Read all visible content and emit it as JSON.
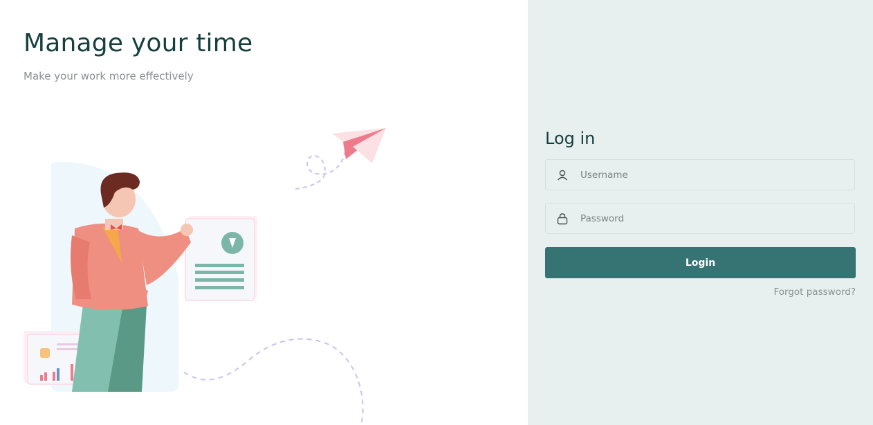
{
  "hero": {
    "title": "Manage your time",
    "subtitle": "Make your work more effectively"
  },
  "login": {
    "title": "Log in",
    "username": {
      "value": "",
      "placeholder": "Username",
      "icon": "user-icon"
    },
    "password": {
      "value": "",
      "placeholder": "Password",
      "icon": "lock-icon"
    },
    "submit_label": "Login",
    "forgot_label": "Forgot password?"
  },
  "colors": {
    "brand_dark": "#15403e",
    "button": "#367373",
    "panel_bg": "#e8f0ef",
    "accent_pink": "#ee7b8c"
  }
}
